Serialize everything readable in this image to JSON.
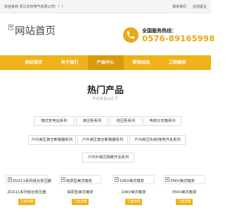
{
  "topbar": {
    "welcome": "欢迎来到 浙江亦欣电气有限公司！！！",
    "links": [
      "联系我们",
      "在线留言"
    ]
  },
  "logo": {
    "alt_text": "网站首页",
    "icon": "broken-image-icon"
  },
  "hotline": {
    "icon": "phone-icon",
    "label": "全国服务热线：",
    "number": "0576-89165998"
  },
  "nav": {
    "items": [
      "网站首页",
      "关于我们",
      "产品中心",
      "新闻动态",
      "工程案例"
    ],
    "active_index": 2
  },
  "section": {
    "title": "热门产品",
    "subtitle": "PORDUCT"
  },
  "categories": [
    "箱式变电站系列",
    "高压柜系列",
    "低压柜系列",
    "电缆分支箱系列",
    "户内高压真空断路器系列",
    "户外高压真空断路器系列",
    "户内高压负荷/接地开关系列",
    "户内外高压隔离开关系列"
  ],
  "products": [
    {
      "image_alt": "ZGS11系列组合变压器",
      "caption": "ZGS11系列组合变压器",
      "more": "了解详情>>"
    },
    {
      "image_alt": "高原型美式箱变",
      "caption": "高原型美式箱变",
      "more": "了解详情>>"
    },
    {
      "image_alt": "10KV美式箱变",
      "caption": "10KV美式箱变",
      "more": "了解详情>>"
    },
    {
      "image_alt": "35KV美式箱变",
      "caption": "35KV美式箱变",
      "more": "了解详情>>"
    }
  ],
  "colors": {
    "accent": "#f0b21b",
    "accent_active": "#d99a0b",
    "phone": "#e8a818"
  }
}
